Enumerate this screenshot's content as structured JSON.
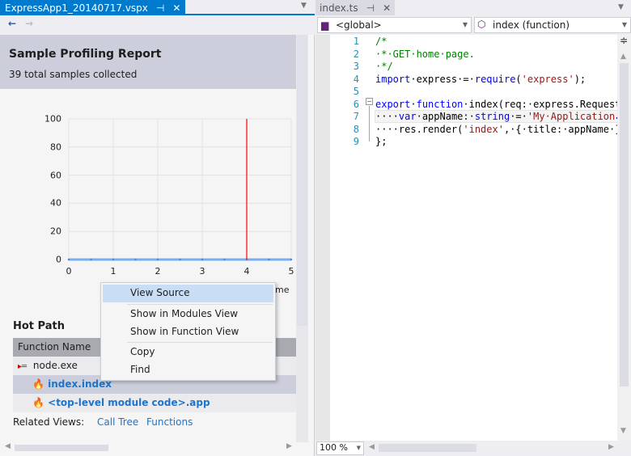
{
  "left_panel": {
    "tab_title": "ExpressApp1_20140717.vspx",
    "report_title": "Sample Profiling Report",
    "samples_text": "39 total samples collected",
    "hot_path_title": "Hot Path",
    "table_header": "Function Name",
    "rows": [
      {
        "name": "node.exe",
        "icon": "process-icon"
      },
      {
        "name": "index.index",
        "icon": "flame-icon"
      },
      {
        "name": "<top-level module code>.app",
        "icon": "flame-icon"
      }
    ],
    "related_views_label": "Related Views:",
    "related_links": [
      "Call Tree",
      "Functions"
    ],
    "x_axis_label_partial": "ime"
  },
  "chart_data": {
    "type": "line",
    "x_ticks": [
      "0",
      "1",
      "2",
      "3",
      "4",
      "5"
    ],
    "y_ticks": [
      "0",
      "20",
      "40",
      "60",
      "80",
      "100"
    ],
    "xlim": [
      0,
      5
    ],
    "ylim": [
      0,
      100
    ],
    "grid": true,
    "series": [
      {
        "x": [
          0,
          0.5,
          1,
          1.5,
          2,
          2.5,
          3,
          3.5,
          4,
          4.5,
          5
        ],
        "y": [
          0,
          0,
          0,
          0,
          0,
          0,
          0,
          0,
          0,
          0,
          0
        ],
        "color": "#7aaef0"
      }
    ],
    "marker_line": {
      "x": 4,
      "color": "#ff0000"
    }
  },
  "context_menu": {
    "items": [
      "View Source",
      "Show in Modules View",
      "Show in Function View",
      "Copy",
      "Find"
    ]
  },
  "right_panel": {
    "tab_title": "index.ts",
    "scope_dropdown": "<global>",
    "member_dropdown": "index (function)",
    "zoom": "100 %",
    "line_numbers": [
      "1",
      "2",
      "3",
      "4",
      "5",
      "6",
      "7",
      "8",
      "9"
    ]
  }
}
